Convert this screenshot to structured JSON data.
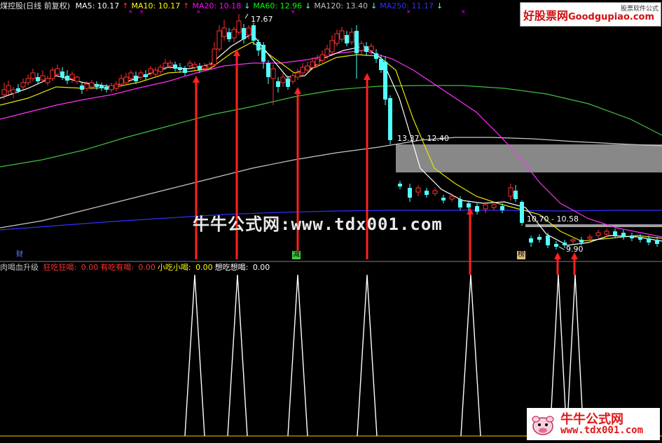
{
  "header": {
    "title": "煤控股(日线 前复权)",
    "ma": [
      {
        "label": "MA5: 10.17",
        "arrow": "↑",
        "color": "#ffffff"
      },
      {
        "label": "MA10: 10.17",
        "arrow": "↑",
        "color": "#ffff00"
      },
      {
        "label": "MA20: 10.18",
        "arrow": "↓",
        "color": "#ff00ff"
      },
      {
        "label": "MA60: 12.96",
        "arrow": "↓",
        "color": "#00ff00"
      },
      {
        "label": "MA120: 13.40",
        "arrow": "↓",
        "color": "#c0c0c0"
      },
      {
        "label": "MA250: 11.17",
        "arrow": "↓",
        "color": "#3030ff"
      }
    ]
  },
  "logo": {
    "cn": "好股票网",
    "en": "Goodgupiao.com",
    "sub": "股票软件公式"
  },
  "annotations": {
    "high": "17.67",
    "range1": "13.37 - 12.40",
    "range2": "10.70 - 10.58",
    "low": "9.90"
  },
  "tags": {
    "cai": "财",
    "jian": "减",
    "bang": "榜"
  },
  "indicator": {
    "name": "肉喝血升级",
    "items": [
      {
        "label": "狂吃狂喝:",
        "value": "0.00",
        "color": "#ff3030"
      },
      {
        "label": "有吃有喝:",
        "value": "0.00",
        "color": "#ff3030"
      },
      {
        "label": "小吃小喝:",
        "value": "0.00",
        "color": "#ffff00"
      },
      {
        "label": "想吃想喝:",
        "value": "0.00",
        "color": "#ffffff"
      }
    ]
  },
  "watermark": {
    "center": "牛牛公式网:www.tdx001.com",
    "bottom_cn": "牛牛公式网",
    "bottom_url": "www.tdx001.com"
  },
  "colors": {
    "up": "#ff3232",
    "down": "#54ffff",
    "background": "#000000"
  }
}
